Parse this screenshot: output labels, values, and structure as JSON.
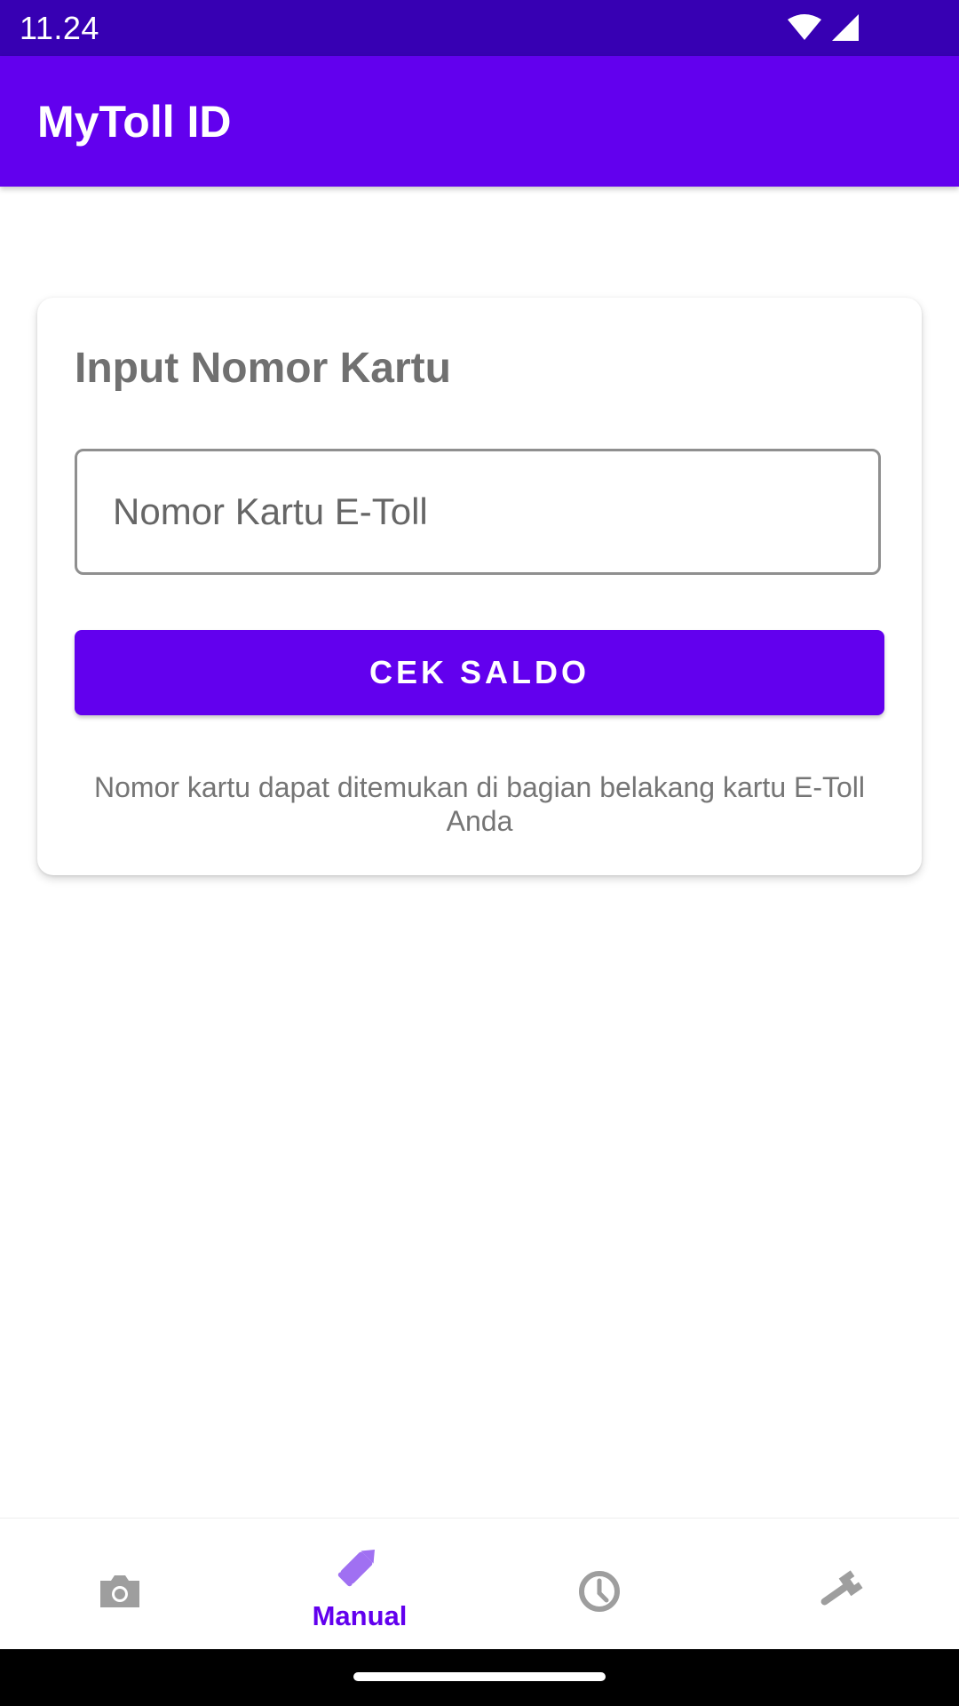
{
  "status_bar": {
    "time": "11.24",
    "icons": [
      "wifi-icon",
      "cellular-signal-icon"
    ]
  },
  "app_bar": {
    "title": "MyToll ID",
    "color": "#6200ee"
  },
  "card": {
    "title": "Input Nomor Kartu",
    "input": {
      "placeholder": "Nomor Kartu E-Toll",
      "value": ""
    },
    "button_label": "CEK SALDO",
    "helper_text": "Nomor kartu dapat ditemukan di bagian belakang kartu E-Toll Anda"
  },
  "bottom_nav": {
    "items": [
      {
        "icon": "camera-icon",
        "label": "",
        "active": false
      },
      {
        "icon": "pencil-icon",
        "label": "Manual",
        "active": true
      },
      {
        "icon": "clock-icon",
        "label": "",
        "active": false
      },
      {
        "icon": "wrench-icon",
        "label": "",
        "active": false
      }
    ],
    "active_color": "#6200ee",
    "inactive_color": "#9e9e9e"
  }
}
